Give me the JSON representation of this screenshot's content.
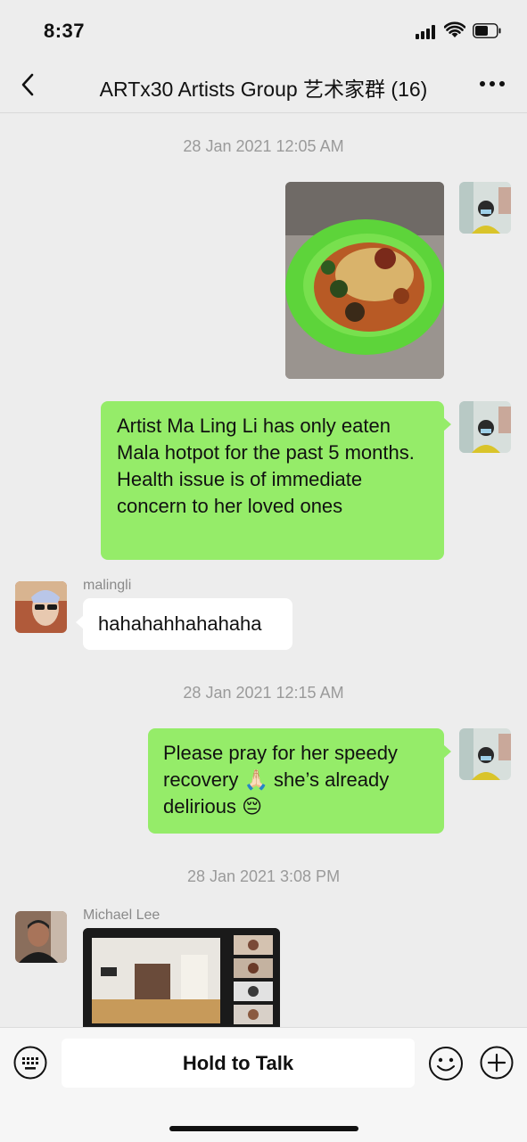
{
  "status": {
    "time": "8:37"
  },
  "header": {
    "title": "ARTx30 Artists Group 艺术家群 (16)",
    "back_icon": "chevron-left-icon",
    "more_icon": "more-dots-icon"
  },
  "timestamps": [
    "28 Jan 2021 12:05 AM",
    "28 Jan 2021 12:15 AM",
    "28 Jan 2021 3:08 PM"
  ],
  "messages": [
    {
      "type": "image",
      "side": "right",
      "description_icon": "food-photo-icon"
    },
    {
      "type": "text",
      "side": "right",
      "text": "Artist Ma Ling Li has only eaten Mala hotpot for the past 5 months. Health issue is of immediate concern to her loved ones"
    },
    {
      "type": "text",
      "side": "left",
      "sender": "malingli",
      "text": "hahahahhahahaha"
    },
    {
      "type": "text",
      "side": "right",
      "text_before": "Please pray for her speedy recovery",
      "emoji1": "🙏🏻",
      "text_after": "she’s already delirious",
      "emoji2": "😔"
    },
    {
      "type": "image",
      "side": "left",
      "sender": "Michael Lee",
      "description_icon": "video-call-screenshot-icon"
    }
  ],
  "input": {
    "hold_to_talk": "Hold to Talk",
    "keyboard_icon": "keyboard-icon",
    "emoji_icon": "emoji-icon",
    "plus_icon": "plus-icon"
  },
  "colors": {
    "background": "#ededed",
    "self_bubble": "#95ec69",
    "other_bubble": "#ffffff"
  }
}
